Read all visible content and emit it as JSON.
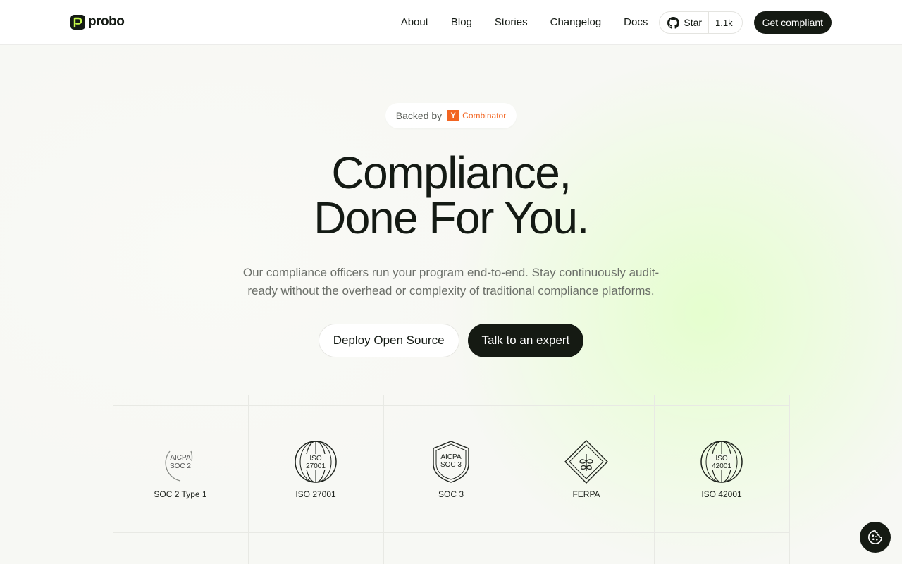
{
  "header": {
    "logo_text": "probo",
    "nav": [
      {
        "label": "About"
      },
      {
        "label": "Blog"
      },
      {
        "label": "Stories"
      },
      {
        "label": "Changelog"
      },
      {
        "label": "Docs"
      }
    ],
    "github": {
      "star_label": "Star",
      "count": "1.1k"
    },
    "cta_label": "Get compliant"
  },
  "hero": {
    "backed_by": "Backed by",
    "yc_letter": "Y",
    "yc_text": "Combinator",
    "title_line1": "Compliance,",
    "title_line2": "Done For You.",
    "subtitle_line1": "Our compliance officers run your program end-to-end. Stay continuously audit-",
    "subtitle_line2": "ready without the overhead or complexity of traditional compliance platforms.",
    "btn_secondary": "Deploy Open Source",
    "btn_primary": "Talk to an expert"
  },
  "certifications": [
    {
      "label": "SOC 2 Type 1",
      "badge_line1": "AICPA",
      "badge_line2": "SOC 2",
      "icon": "soc2-badge-icon"
    },
    {
      "label": "ISO 27001",
      "badge_line1": "ISO",
      "badge_line2": "27001",
      "icon": "iso-globe-icon"
    },
    {
      "label": "SOC 3",
      "badge_line1": "AICPA",
      "badge_line2": "SOC 3",
      "icon": "shield-icon"
    },
    {
      "label": "FERPA",
      "icon": "ferpa-diamond-icon"
    },
    {
      "label": "ISO 42001",
      "badge_line1": "ISO",
      "badge_line2": "42001",
      "icon": "iso-globe-icon"
    }
  ],
  "colors": {
    "accent_dark": "#151a13",
    "brand_green": "#c6f94a",
    "yc_orange": "#f26522"
  }
}
